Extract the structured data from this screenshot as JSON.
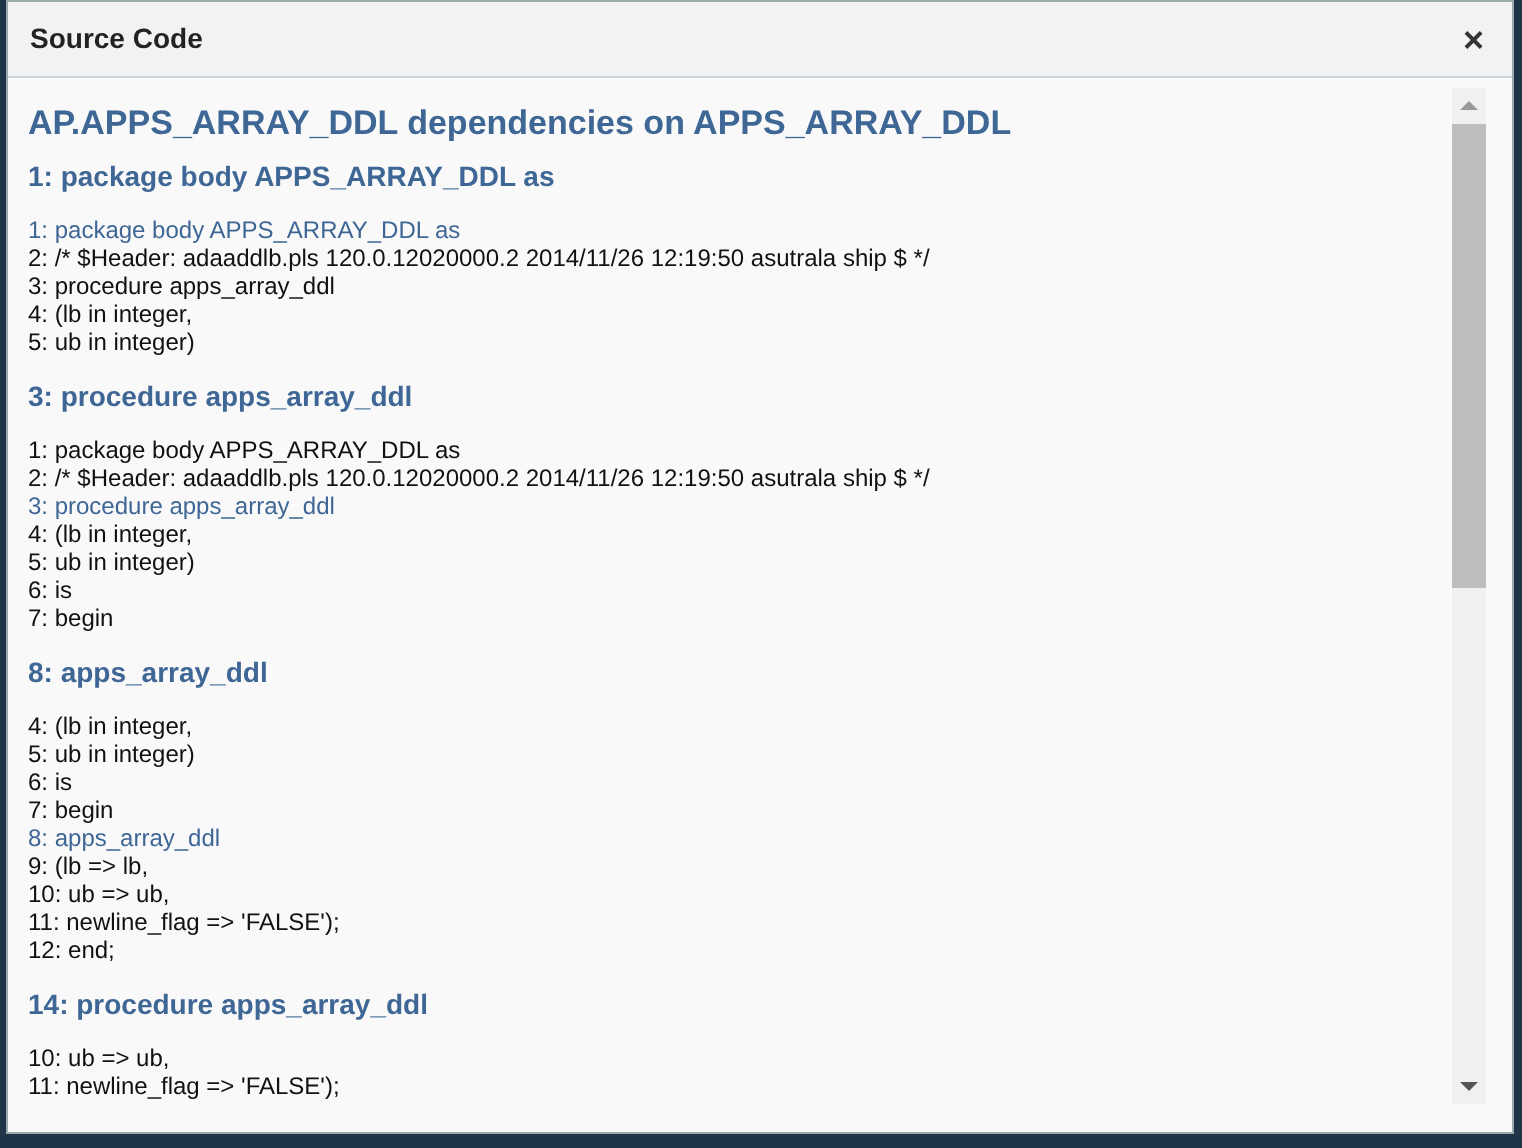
{
  "dialog": {
    "title": "Source Code",
    "close": "×"
  },
  "heading": "AP.APPS_ARRAY_DDL dependencies on APPS_ARRAY_DDL",
  "sections": [
    {
      "title": "1: package body APPS_ARRAY_DDL as",
      "lines": [
        {
          "text": "1: package body APPS_ARRAY_DDL as",
          "highlight": true
        },
        {
          "text": "2: /* $Header: adaaddlb.pls 120.0.12020000.2 2014/11/26 12:19:50 asutrala ship $ */",
          "highlight": false
        },
        {
          "text": "3: procedure apps_array_ddl",
          "highlight": false
        },
        {
          "text": "4: (lb in integer,",
          "highlight": false
        },
        {
          "text": "5: ub in integer)",
          "highlight": false
        }
      ]
    },
    {
      "title": "3: procedure apps_array_ddl",
      "lines": [
        {
          "text": "1: package body APPS_ARRAY_DDL as",
          "highlight": false
        },
        {
          "text": "2: /* $Header: adaaddlb.pls 120.0.12020000.2 2014/11/26 12:19:50 asutrala ship $ */",
          "highlight": false
        },
        {
          "text": "3: procedure apps_array_ddl",
          "highlight": true
        },
        {
          "text": "4: (lb in integer,",
          "highlight": false
        },
        {
          "text": "5: ub in integer)",
          "highlight": false
        },
        {
          "text": "6: is",
          "highlight": false
        },
        {
          "text": "7: begin",
          "highlight": false
        }
      ]
    },
    {
      "title": "8: apps_array_ddl",
      "lines": [
        {
          "text": "4: (lb in integer,",
          "highlight": false
        },
        {
          "text": "5: ub in integer)",
          "highlight": false
        },
        {
          "text": "6: is",
          "highlight": false
        },
        {
          "text": "7: begin",
          "highlight": false
        },
        {
          "text": "8: apps_array_ddl",
          "highlight": true
        },
        {
          "text": "9: (lb => lb,",
          "highlight": false
        },
        {
          "text": "10: ub => ub,",
          "highlight": false
        },
        {
          "text": "11: newline_flag => 'FALSE');",
          "highlight": false
        },
        {
          "text": "12: end;",
          "highlight": false
        }
      ]
    },
    {
      "title": "14: procedure apps_array_ddl",
      "lines": [
        {
          "text": "10: ub => ub,",
          "highlight": false
        },
        {
          "text": "11: newline_flag => 'FALSE');",
          "highlight": false
        }
      ]
    }
  ]
}
